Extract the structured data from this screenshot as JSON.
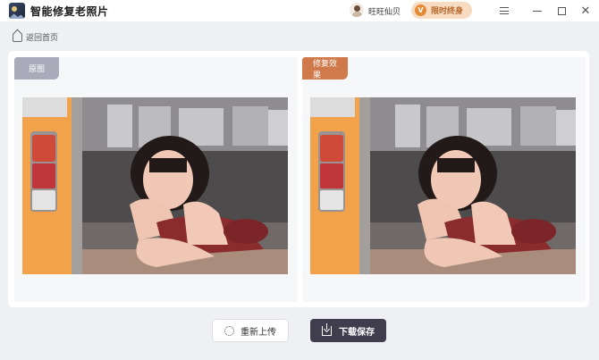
{
  "app": {
    "title": "智能修复老照片",
    "user_name": "旺旺仙贝",
    "vip_label": "限时终身",
    "vip_icon_text": "V",
    "close_glyph": "✕"
  },
  "nav": {
    "back_label": "返回首页"
  },
  "compare": {
    "original_tag": "原图",
    "result_tag": "修复效果"
  },
  "actions": {
    "reupload_label": "重新上传",
    "download_label": "下载保存"
  },
  "colors": {
    "accent_orange": "#d0794a",
    "tag_gray": "#a9abbb",
    "download_bg": "#3f3d4e",
    "vip_bg": "#f7dcc1"
  },
  "icons": {
    "app": "photo-restore-logo",
    "back": "home-icon",
    "reupload": "refresh-icon",
    "download": "download-icon"
  }
}
